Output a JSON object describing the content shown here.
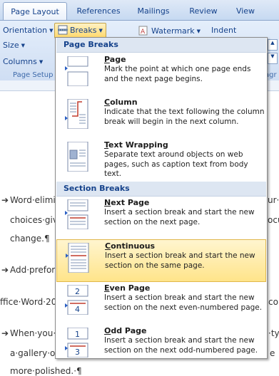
{
  "tabs": [
    {
      "label": "Page Layout",
      "active": true
    },
    {
      "label": "References",
      "active": false
    },
    {
      "label": "Mailings",
      "active": false
    },
    {
      "label": "Review",
      "active": false
    },
    {
      "label": "View",
      "active": false
    }
  ],
  "ribbon": {
    "orientation": "Orientation",
    "breaks": "Breaks",
    "watermark": "Watermark",
    "indent": "Indent",
    "size": "Size",
    "columns": "Columns",
    "group_label": "Page Setup",
    "right_group_label_partial": "agr"
  },
  "document": {
    "line1": "Word·elimi",
    "line1_right": "ur·",
    "line2": "choices·giv",
    "line2_right": "ocu",
    "line3": "change.¶",
    "line4": "Add·prefor",
    "line5": "ffice·Word·20",
    "line5_right": "co",
    "line6": "When·you·",
    "line6_right": "·ty",
    "line7": "a·gallery·o",
    "line7_right": "e",
    "line8": "more·polished.·¶"
  },
  "menu": {
    "page_breaks_header": "Page Breaks",
    "section_breaks_header": "Section Breaks",
    "items": [
      {
        "key": "P",
        "rest": "age",
        "description": "Mark the point at which one page ends and the next page begins.",
        "icon": "page-break-icon"
      },
      {
        "key": "C",
        "rest": "olumn",
        "description": "Indicate that the text following the column break will begin in the next column.",
        "icon": "column-break-icon"
      },
      {
        "key": "T",
        "rest": "ext Wrapping",
        "description": "Separate text around objects on web pages, such as caption text from body text.",
        "icon": "text-wrapping-icon"
      },
      {
        "key": "N",
        "rest": "ext Page",
        "description": "Insert a section break and start the new section on the next page.",
        "icon": "next-page-icon"
      },
      {
        "key": "C",
        "rest": "ontinuous",
        "description": "Insert a section break and start the new section on the same page.",
        "icon": "continuous-icon",
        "highlighted": true
      },
      {
        "key": "E",
        "rest": "ven Page",
        "description": "Insert a section break and start the new section on the next even-numbered page.",
        "icon": "even-page-icon"
      },
      {
        "key": "O",
        "rest": "dd Page",
        "description": "Insert a section break and start the new section on the next odd-numbered page.",
        "icon": "odd-page-icon"
      }
    ]
  },
  "icon_badges": {
    "even": "2",
    "even_next": "4",
    "odd": "1",
    "odd_next": "3"
  },
  "colors": {
    "ribbon_text": "#15428b",
    "highlight": "#ffe48a",
    "section_marker": "#c03a2b"
  }
}
